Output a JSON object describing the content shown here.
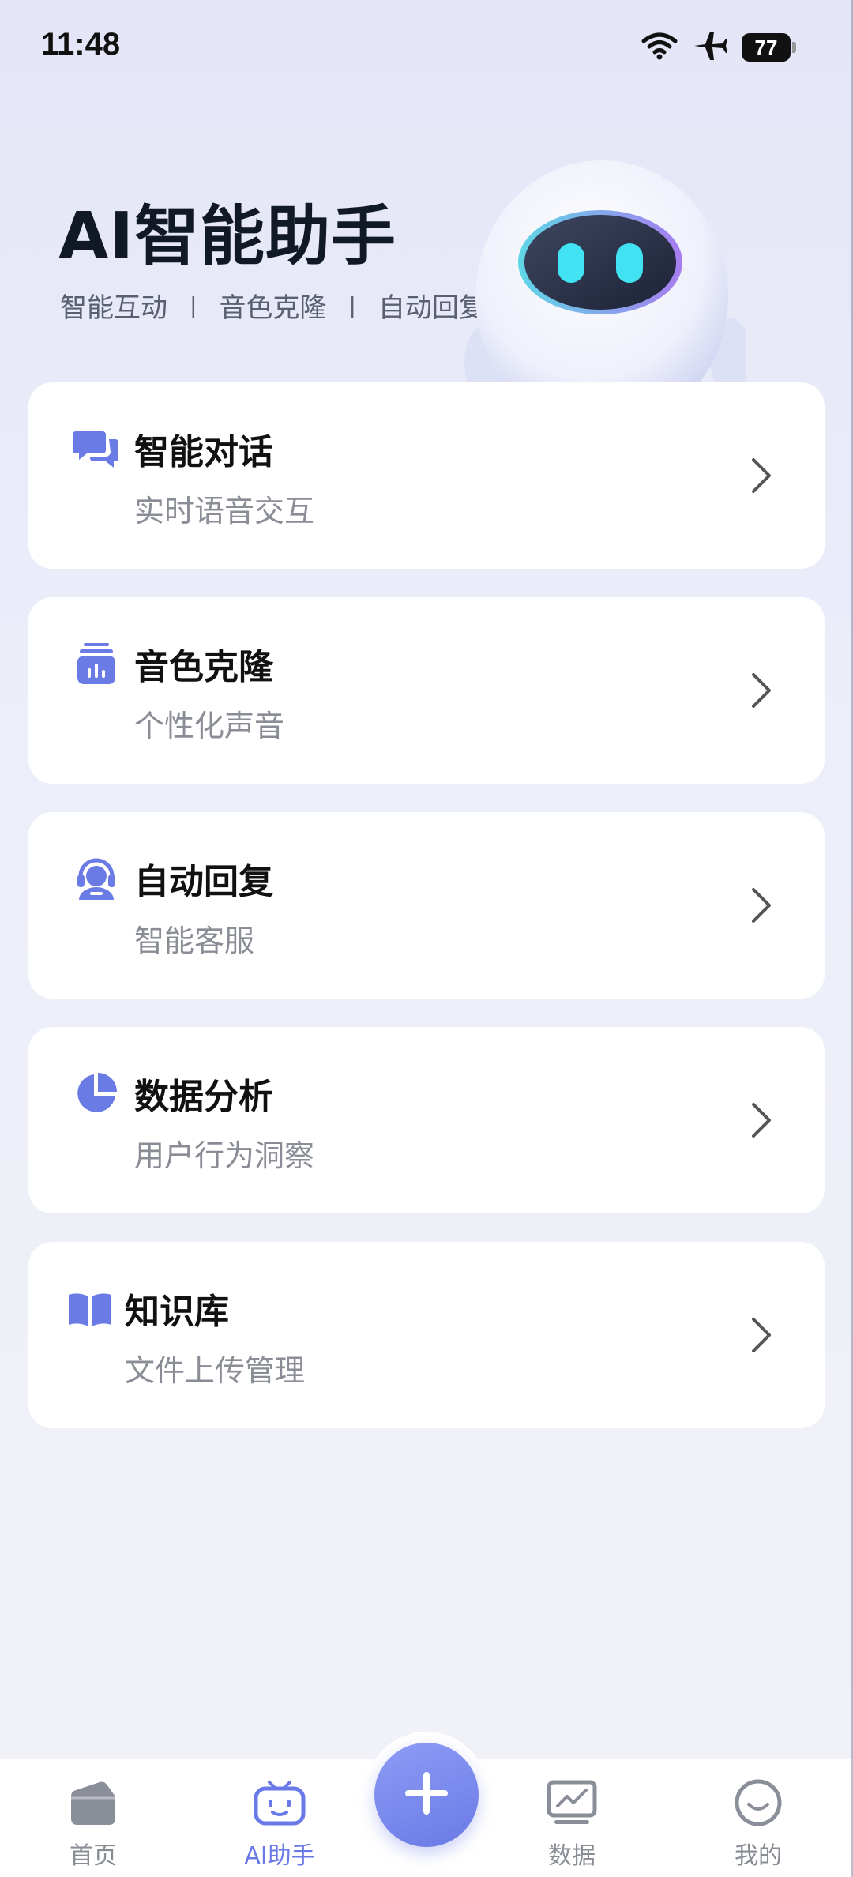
{
  "status_bar": {
    "time": "11:48",
    "battery": "77"
  },
  "hero": {
    "title": "AI智能助手",
    "tags": [
      "智能互动",
      "音色克隆",
      "自动回复"
    ],
    "separator": "|"
  },
  "features": [
    {
      "title": "智能对话",
      "subtitle": "实时语音交互",
      "icon": "chat-bubbles-icon"
    },
    {
      "title": "音色克隆",
      "subtitle": "个性化声音",
      "icon": "voice-clone-icon"
    },
    {
      "title": "自动回复",
      "subtitle": "智能客服",
      "icon": "customer-service-icon"
    },
    {
      "title": "数据分析",
      "subtitle": "用户行为洞察",
      "icon": "pie-chart-icon"
    },
    {
      "title": "知识库",
      "subtitle": "文件上传管理",
      "icon": "book-icon"
    }
  ],
  "tabbar": {
    "tabs": [
      {
        "label": "首页",
        "icon": "home-icon"
      },
      {
        "label": "AI助手",
        "icon": "robot-tv-icon"
      },
      {
        "label": "数据",
        "icon": "chart-monitor-icon"
      },
      {
        "label": "我的",
        "icon": "smile-icon"
      }
    ],
    "active": "AI助手",
    "center_button_icon": "plus-icon"
  },
  "colors": {
    "accent": "#6a79e8",
    "icon": "#6b7be6",
    "title": "#111826",
    "subtitle": "#8a8d96"
  }
}
